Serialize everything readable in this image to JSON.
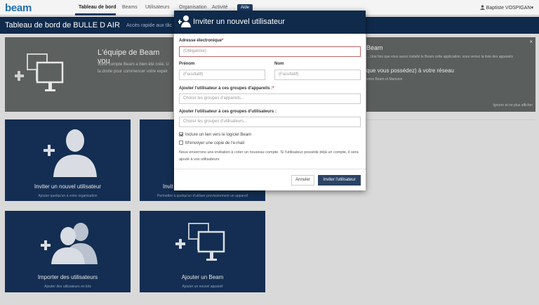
{
  "app": {
    "logo": "beam"
  },
  "nav": {
    "items": [
      "Tableau de bord",
      "Beams",
      "Utilisateurs",
      "Organisation",
      "Activité"
    ],
    "badge": "Aide",
    "user": "Baptiste VOSPIGAN"
  },
  "titlebar": {
    "title": "Tableau de bord de BULLE D AIR",
    "subtitle": "Accès rapide aux tâc"
  },
  "banner_left": {
    "title": "L'équipe de Beam vou",
    "desc_line1": "Votre compte Beam a bien été créé. U",
    "desc_line2": "la droite pour commencer votre expér"
  },
  "banner_right": {
    "title": "Beam",
    "desc": "... Une fois que vous aurez installé le Beam cette application, vous verrez la liste des appareils",
    "title2": "que vous possédez) à votre réseau",
    "desc2": "votre Beam et Mansion",
    "hide": "Ignorer et ne plus afficher",
    "close": "×"
  },
  "tiles": [
    {
      "label": "Inviter un nouvel utilisateur",
      "sub": "Ajouter quelqu'un à votre organisation"
    },
    {
      "label": "Invit",
      "sub": "Permettre à quelqu'un d'utiliser provisoirement un appareil"
    },
    {
      "label": "Importer des utilisateurs",
      "sub": "Ajouter des utilisateurs en lots"
    },
    {
      "label": "Ajouter un Beam",
      "sub": "Ajouter un nouvel appareil"
    }
  ],
  "modal": {
    "title": "Inviter un nouvel utilisateur",
    "email_label": "Adresse électronique",
    "email_req": "*",
    "email_placeholder": "(Obligatoire)",
    "firstname_label": "Prénom",
    "firstname_placeholder": "(Facultatif)",
    "lastname_label": "Nom",
    "lastname_placeholder": "(Facultatif)",
    "device_groups_label": "Ajouter l'utilisateur à ces groupes d'appareils :",
    "device_groups_req": "*",
    "device_groups_placeholder": "Choisir les groupes d'appareils...",
    "user_groups_label": "Ajouter l'utilisateur à ces groupes d'utilisateurs :",
    "user_groups_placeholder": "Choisir les groupes d'utilisateurs...",
    "chk1_label": "Inclure un lien vers le logiciel Beam",
    "chk2_label": "M'envoyer une copie de l'e-mail",
    "note": "Nous enverrons une invitation à créer un nouveau compte. Si l'utilisateur possède déjà un compte, il sera ajouté à vos utilisateurs",
    "cancel": "Annuler",
    "invite": "Inviter l'utilisateur"
  }
}
